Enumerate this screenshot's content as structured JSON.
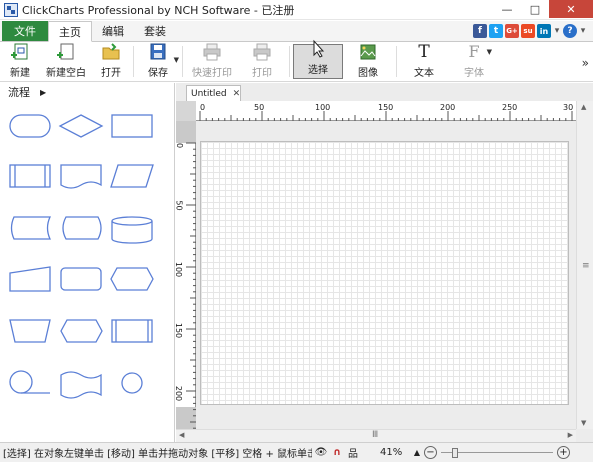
{
  "window": {
    "title": "ClickCharts Professional by NCH Software - 已注册",
    "controls": [
      "—",
      "□",
      "✕"
    ]
  },
  "ribbon": {
    "file_tab": "文件",
    "tabs": [
      "主页",
      "编辑",
      "套装"
    ],
    "active_tab": "主页",
    "social": [
      {
        "name": "facebook-icon",
        "glyph": "f",
        "color": "#3b5998"
      },
      {
        "name": "twitter-icon",
        "glyph": "t",
        "color": "#1da1f2"
      },
      {
        "name": "googleplus-icon",
        "glyph": "G+",
        "color": "#dd4b39"
      },
      {
        "name": "stumbleupon-icon",
        "glyph": "su",
        "color": "#eb4924"
      },
      {
        "name": "linkedin-icon",
        "glyph": "in",
        "color": "#0077b5"
      }
    ],
    "help": "?"
  },
  "toolbar": {
    "new": "新建",
    "new_blank": "新建空白",
    "open": "打开",
    "save": "保存",
    "quick_print": "快速打印",
    "print": "打印",
    "select": "选择",
    "image": "图像",
    "text": "文本",
    "font": "字体",
    "more": "»"
  },
  "library": {
    "category": "流程"
  },
  "document": {
    "tab_name": "Untitled",
    "ruler_x": [
      "0",
      "50",
      "100",
      "150",
      "200",
      "250",
      "30"
    ],
    "ruler_y": [
      "0",
      "50",
      "100",
      "150",
      "200"
    ],
    "accent": "#5b7fd6"
  },
  "status": {
    "text": "[选择] 在对象左键单击 [移动] 单击并拖动对象 [平移] 空格 + 鼠标单击并",
    "zoom": "41%",
    "zoom_level_percent": 41
  }
}
